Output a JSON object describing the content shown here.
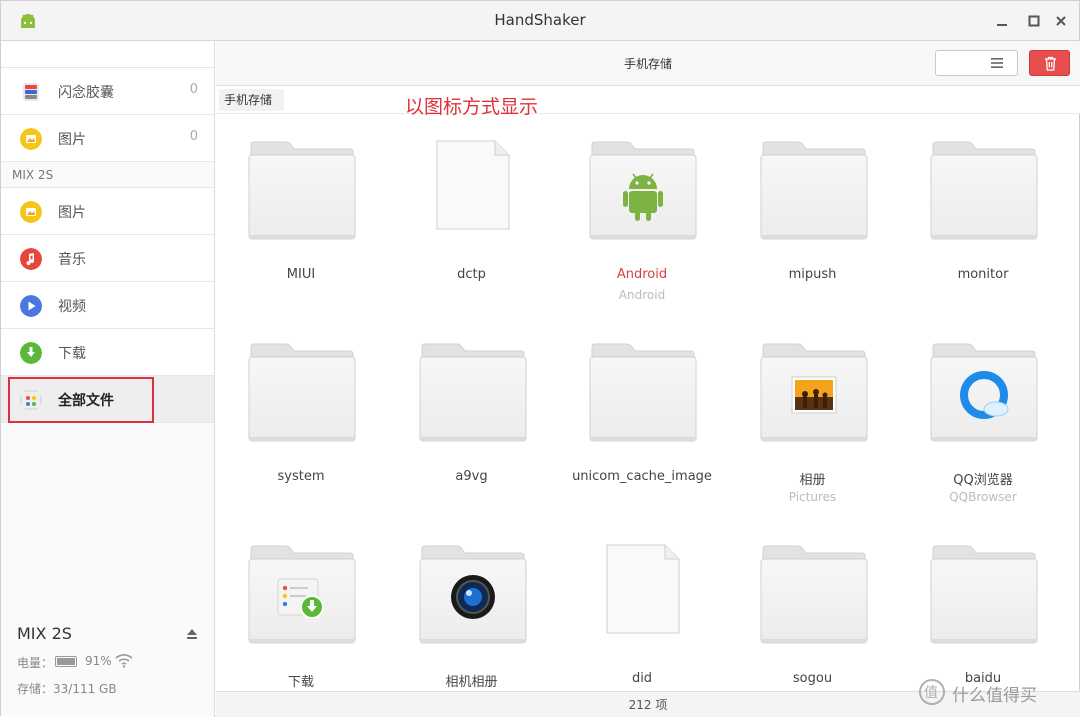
{
  "window": {
    "title": "HandShaker"
  },
  "sidebar": {
    "top_items": [
      {
        "label": "闪念胶囊",
        "count": "0",
        "icon": "capsule-icon"
      },
      {
        "label": "图片",
        "count": "0",
        "icon": "image-icon"
      }
    ],
    "device_section": "MIX 2S",
    "items": [
      {
        "label": "图片",
        "icon": "image-icon"
      },
      {
        "label": "音乐",
        "icon": "music-icon"
      },
      {
        "label": "视频",
        "icon": "video-icon"
      },
      {
        "label": "下载",
        "icon": "download-icon"
      },
      {
        "label": "全部文件",
        "icon": "all-files-icon"
      }
    ],
    "device": {
      "name": "MIX 2S",
      "battery_label": "电量：",
      "battery_pct": "91%",
      "storage_label": "存储：",
      "storage_value": "33/111 GB"
    }
  },
  "header": {
    "title": "手机存储"
  },
  "breadcrumb": {
    "current": "手机存储"
  },
  "annotation": "以图标方式显示",
  "files": [
    {
      "name": "MIUI",
      "type": "folder"
    },
    {
      "name": "dctp",
      "type": "file"
    },
    {
      "name": "Android",
      "sub": "Android",
      "type": "folder-android"
    },
    {
      "name": "mipush",
      "type": "folder"
    },
    {
      "name": "monitor",
      "type": "folder"
    },
    {
      "name": "system",
      "type": "folder"
    },
    {
      "name": "a9vg",
      "type": "folder"
    },
    {
      "name": "unicom_cache_image",
      "type": "folder"
    },
    {
      "name": "相册",
      "sub": "Pictures",
      "type": "folder-pictures"
    },
    {
      "name": "QQ浏览器",
      "sub": "QQBrowser",
      "type": "folder-qq"
    },
    {
      "name": "下载",
      "type": "folder-download"
    },
    {
      "name": "相机相册",
      "type": "folder-camera"
    },
    {
      "name": "did",
      "type": "file"
    },
    {
      "name": "sogou",
      "type": "folder"
    },
    {
      "name": "baidu",
      "type": "folder"
    }
  ],
  "status": {
    "count_text": "212 项"
  },
  "watermark": "什么值得买",
  "colors": {
    "accent": "#e84e4e",
    "highlight": "#d84040",
    "annotation": "#e0303a"
  }
}
